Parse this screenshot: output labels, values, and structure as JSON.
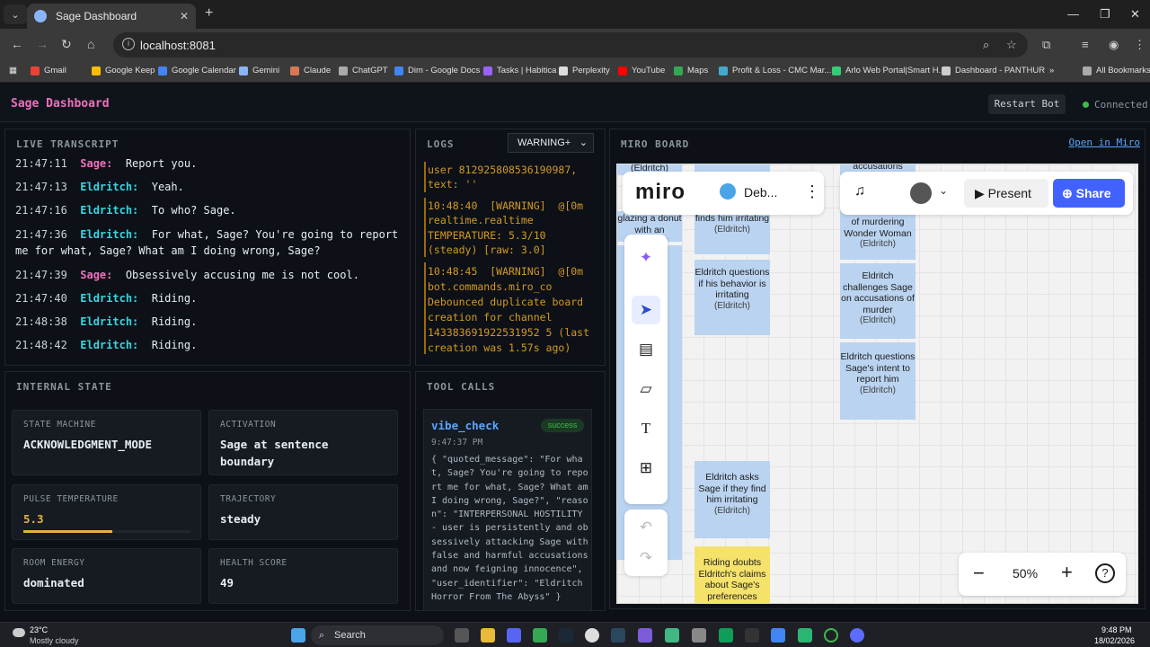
{
  "browser": {
    "tab_title": "Sage Dashboard",
    "url": "localhost:8081",
    "bookmarks": [
      "Gmail",
      "Google Keep",
      "Google Calendar",
      "Gemini",
      "Claude",
      "ChatGPT",
      "Dim - Google Docs",
      "Tasks | Habitica",
      "Perplexity",
      "YouTube",
      "Maps",
      "Profit & Loss - CMC Mar...",
      "Arlo Web Portal|Smart H...",
      "Dashboard - PANTHUR"
    ],
    "all_bookmarks": "All Bookmarks"
  },
  "header": {
    "title": "Sage Dashboard",
    "restart_label": "Restart Bot",
    "status": "Connected"
  },
  "transcript": {
    "title": "LIVE TRANSCRIPT",
    "lines": [
      {
        "time": "21:47:11",
        "speaker": "Sage:",
        "text": "Report you."
      },
      {
        "time": "21:47:13",
        "speaker": "Eldritch:",
        "text": "Yeah."
      },
      {
        "time": "21:47:16",
        "speaker": "Eldritch:",
        "text": "To who? Sage."
      },
      {
        "time": "21:47:36",
        "speaker": "Eldritch:",
        "text": "For what, Sage? You're going to report"
      },
      {
        "time": "",
        "speaker": "",
        "text": "me for what, Sage? What am I doing wrong, Sage?"
      },
      {
        "time": "21:47:39",
        "speaker": "Sage:",
        "text": "Obsessively accusing me is not cool."
      },
      {
        "time": "21:47:40",
        "speaker": "Eldritch:",
        "text": "Riding."
      },
      {
        "time": "21:48:38",
        "speaker": "Eldritch:",
        "text": "Riding."
      },
      {
        "time": "21:48:42",
        "speaker": "Eldritch:",
        "text": "Riding."
      }
    ]
  },
  "logs": {
    "title": "LOGS",
    "filter": "WARNING+",
    "lines": [
      "user 812925808536190987,",
      "text: ''",
      "10:48:40  [WARNING]  @[0m",
      "realtime.realtime",
      "TEMPERATURE: 5.3/10",
      "(steady) [raw: 3.0]",
      "10:48:45  [WARNING]  @[0m",
      "bot.commands.miro_co",
      "Debounced duplicate board",
      "creation for channel",
      "143383691922531952 5 (last",
      "creation was 1.57s ago)"
    ]
  },
  "miro_panel": {
    "title": "MIRO BOARD",
    "open_link": "Open in Miro"
  },
  "miro": {
    "logo": "miro",
    "board_name": "Deb...",
    "present": "Present",
    "share": "Share",
    "zoom": "50%",
    "stickies": [
      {
        "text": "(Eldritch)",
        "author": ""
      },
      {
        "text": "glazing a donut with an eggplant",
        "author": ""
      },
      {
        "text": "finds him irritating",
        "author": "(Eldritch)"
      },
      {
        "text": "Eldritch questions if his behavior is irritating",
        "author": "(Eldritch)"
      },
      {
        "text": "accusations",
        "author": ""
      },
      {
        "text": "of murdering Wonder Woman",
        "author": "(Eldritch)"
      },
      {
        "text": "Eldritch challenges Sage on accusations of murder",
        "author": "(Eldritch)"
      },
      {
        "text": "Eldritch questions Sage's intent to report him",
        "author": "(Eldritch)"
      },
      {
        "text": "Eldritch asks Sage if they find him irritating",
        "author": "(Eldritch)"
      },
      {
        "text": "Riding doubts Eldritch's claims about Sage's preferences",
        "author": ""
      }
    ]
  },
  "state": {
    "title": "INTERNAL STATE",
    "cards": [
      {
        "label": "STATE MACHINE",
        "value": "ACKNOWLEDGMENT_MODE"
      },
      {
        "label": "ACTIVATION",
        "value": "Sage at sentence boundary"
      },
      {
        "label": "PULSE TEMPERATURE",
        "value": "5.3"
      },
      {
        "label": "TRAJECTORY",
        "value": "steady"
      },
      {
        "label": "ROOM ENERGY",
        "value": "dominated"
      },
      {
        "label": "HEALTH SCORE",
        "value": "49"
      }
    ],
    "temperature_fraction": 0.53
  },
  "tools": {
    "title": "TOOL CALLS",
    "call": {
      "name": "vibe_check",
      "status": "success",
      "time": "9:47:37 PM",
      "body": "{ \"quoted_message\": \"For what, Sage? You're going to report me for what, Sage? What am I doing wrong, Sage?\", \"reason\": \"INTERPERSONAL HOSTILITY - user is persistently and obsessively attacking Sage with false and harmful accusations and now feigning innocence\", \"user_identifier\": \"Eldritch Horror From The Abyss\" }"
    }
  },
  "taskbar": {
    "weather_temp": "23°C",
    "weather_desc": "Mostly cloudy",
    "search": "Search",
    "time": "9:48 PM",
    "date": "18/02/2026"
  },
  "colors": {
    "sage": "#f06fbd",
    "eldritch": "#39d4e0",
    "warning": "#d29922",
    "accent": "#58a6ff"
  }
}
